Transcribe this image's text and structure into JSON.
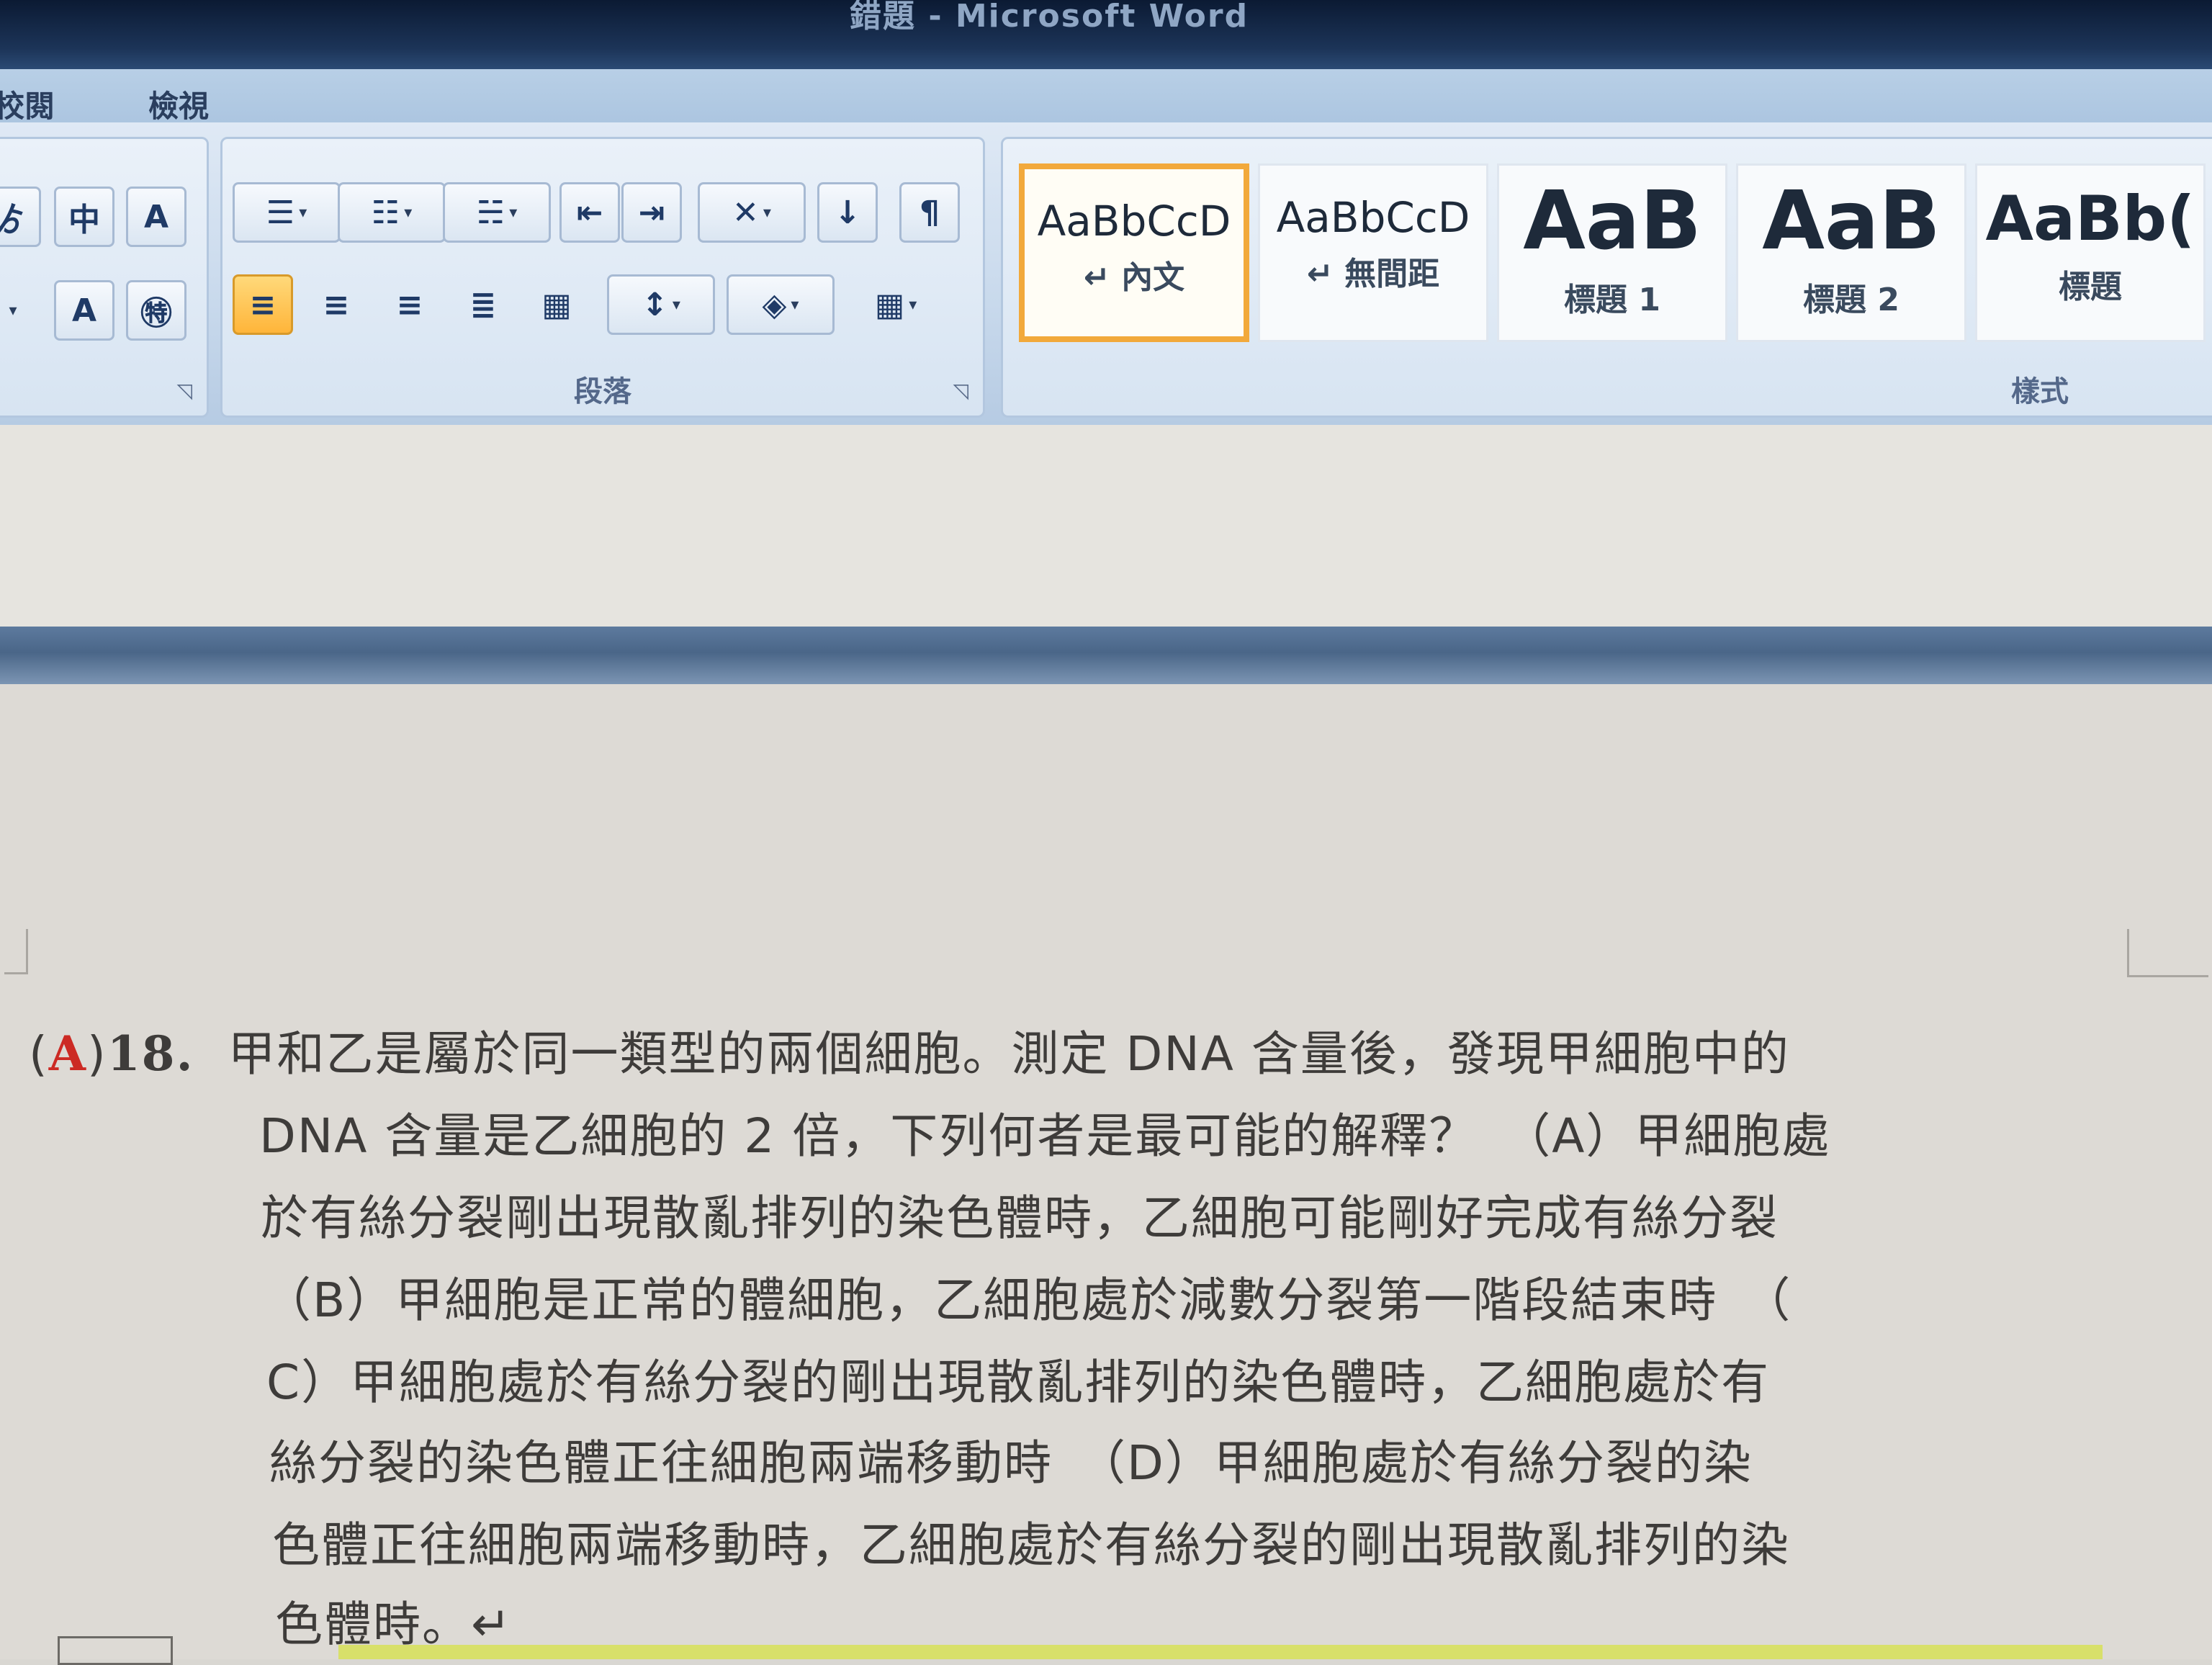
{
  "window": {
    "title": "錯題 - Microsoft Word"
  },
  "tabs": [
    "校閱",
    "檢視"
  ],
  "ribbon": {
    "groups": {
      "paragraph": "段落",
      "styles": "樣式"
    },
    "styles": [
      {
        "sample": "AaBbCcD",
        "name": "↵ 內文",
        "selected": true
      },
      {
        "sample": "AaBbCcD",
        "name": "↵ 無間距",
        "selected": false
      },
      {
        "sample": "AaB",
        "name": "標題 1",
        "selected": false
      },
      {
        "sample": "AaB",
        "name": "標題 2",
        "selected": false
      },
      {
        "sample": "AaBb(",
        "name": "標題",
        "selected": false
      }
    ],
    "icons": {
      "font_group": [
        "phonetic-guide-icon",
        "character-border-icon",
        "character-shading-icon",
        "enclose-characters-icon"
      ],
      "paragraph": [
        "bullets-icon",
        "numbering-icon",
        "multilevel-list-icon",
        "decrease-indent-icon",
        "increase-indent-icon",
        "chinese-layout-icon",
        "sort-icon",
        "show-marks-icon",
        "align-left-icon",
        "center-icon",
        "align-right-icon",
        "justify-icon",
        "distributed-icon",
        "line-spacing-icon",
        "shading-icon",
        "borders-icon"
      ]
    }
  },
  "document": {
    "answer_open": "(",
    "answer": "A",
    "answer_close": ")",
    "number": "18.",
    "lines": [
      "甲和乙是屬於同一類型的兩個細胞。測定 DNA 含量後，發現甲細胞中的",
      "DNA 含量是乙細胞的 2 倍，下列何者是最可能的解釋？　（A）甲細胞處",
      "於有絲分裂剛出現散亂排列的染色體時，乙細胞可能剛好完成有絲分裂",
      "（B）甲細胞是正常的體細胞，乙細胞處於減數分裂第一階段結束時　（",
      "C）甲細胞處於有絲分裂的剛出現散亂排列的染色體時，乙細胞處於有",
      "絲分裂的染色體正往細胞兩端移動時　（D）甲細胞處於有絲分裂的染",
      "色體正往細胞兩端移動時，乙細胞處於有絲分裂的剛出現散亂排列的染",
      "色體時。↵"
    ]
  },
  "colors": {
    "answer": "#cc2a24",
    "selected_style_border": "#f2a93b",
    "active_align": "#ffb53a"
  }
}
